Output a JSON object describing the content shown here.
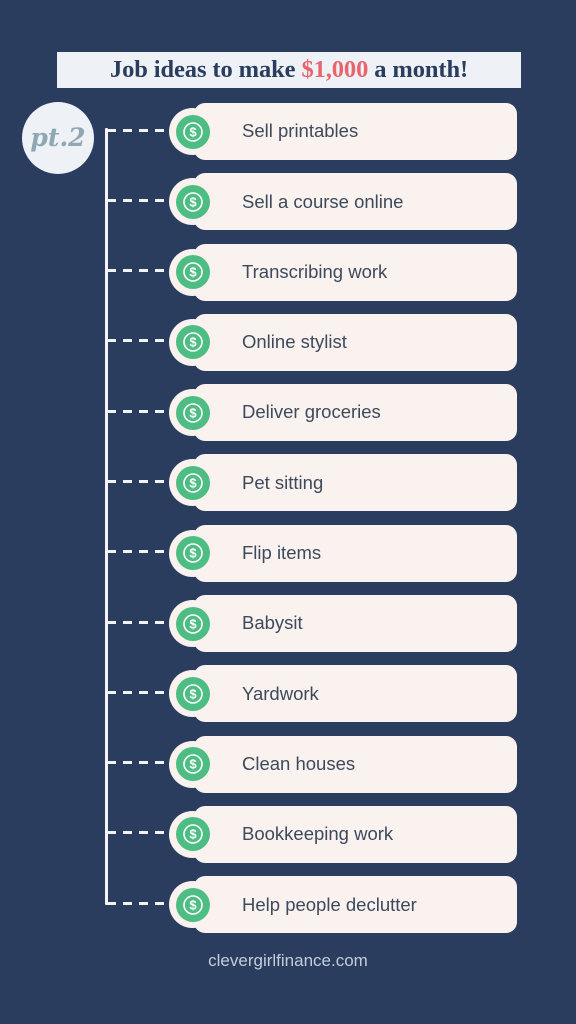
{
  "background_color": "#2b3d5e",
  "header": {
    "title_prefix": "Job ideas to make ",
    "title_amount": "$1,000",
    "title_suffix": " a month!",
    "title_full": "Job ideas to make $1,000 a month!",
    "amount_color": "#e8656c",
    "banner_color": "#eef1f5",
    "title_color": "#2b3d5e"
  },
  "badge": {
    "label": "pt.2",
    "icon": "circle-badge-icon",
    "background_color": "#eef1f5",
    "text_color": "#8fa6b4"
  },
  "list": {
    "bullet_icon": "dollar-coin-icon",
    "bullet_color": "#4dbd84",
    "card_color": "#faf2ef",
    "card_text_color": "#3d4a5c",
    "connector_color": "#f2f4f7",
    "items": [
      {
        "label": "Sell printables"
      },
      {
        "label": "Sell a course online"
      },
      {
        "label": "Transcribing work"
      },
      {
        "label": "Online stylist"
      },
      {
        "label": "Deliver groceries"
      },
      {
        "label": "Pet sitting"
      },
      {
        "label": "Flip items"
      },
      {
        "label": "Babysit"
      },
      {
        "label": "Yardwork"
      },
      {
        "label": "Clean houses"
      },
      {
        "label": "Bookkeeping work"
      },
      {
        "label": "Help people declutter"
      }
    ]
  },
  "footer": {
    "text": "clevergirlfinance.com",
    "color": "#c3cdda"
  }
}
